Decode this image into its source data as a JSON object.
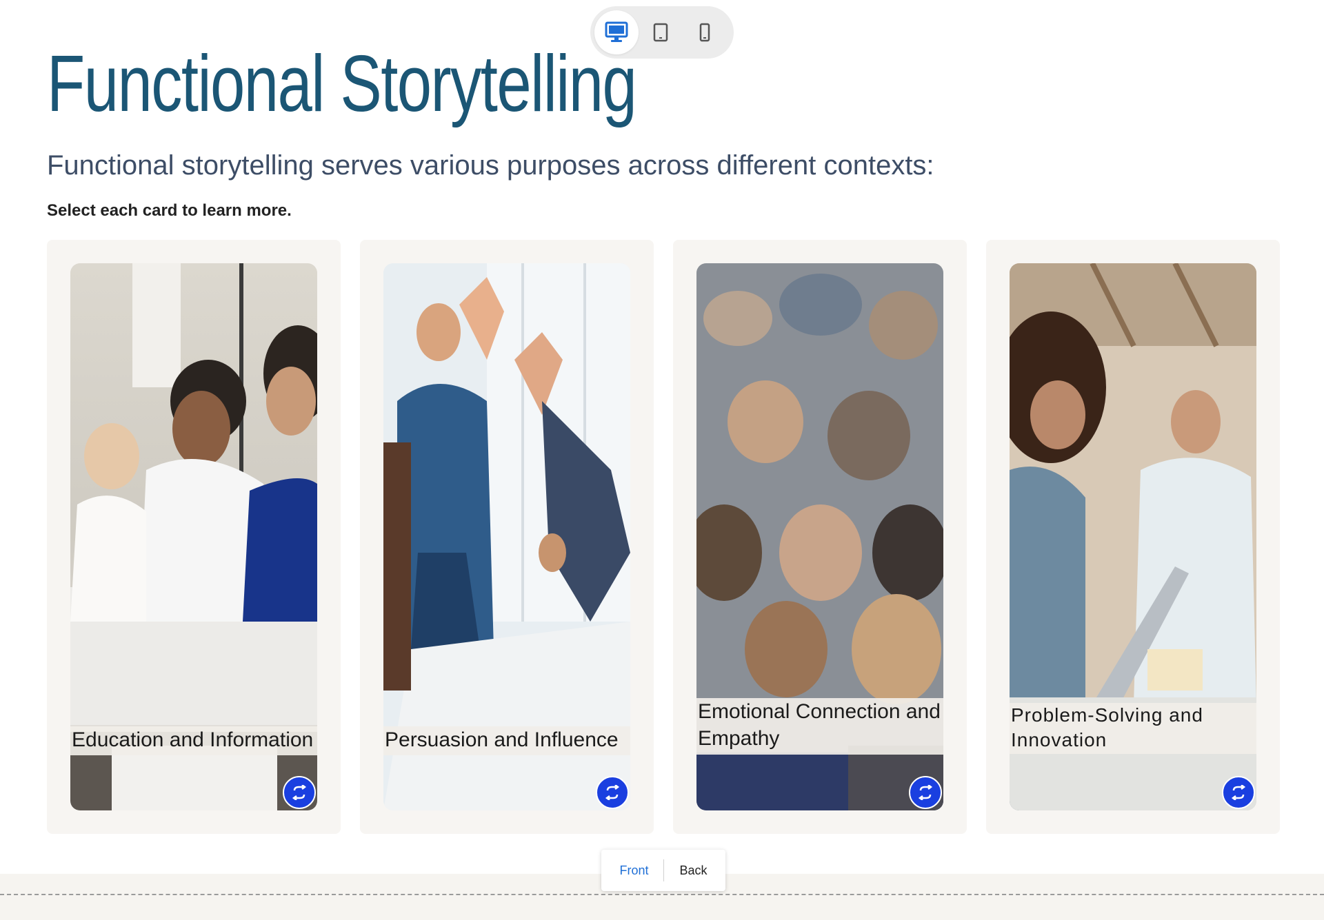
{
  "device_toggle": {
    "options": [
      {
        "icon": "desktop-icon",
        "active": true
      },
      {
        "icon": "tablet-icon",
        "active": false
      },
      {
        "icon": "mobile-icon",
        "active": false
      }
    ],
    "accent": "#1f6fd6"
  },
  "page": {
    "title": "Functional Storytelling",
    "subtitle": "Functional storytelling serves various purposes across different contexts:",
    "instruction": "Select each card to learn more."
  },
  "cards": [
    {
      "label": "Education and Information",
      "label_small_word": "and",
      "flip_icon": "flip-icon"
    },
    {
      "label": "Persuasion and Influence",
      "flip_icon": "flip-icon"
    },
    {
      "label": "Emotional Connection and Empathy",
      "flip_icon": "flip-icon"
    },
    {
      "label": "Problem-Solving and Innovation",
      "flip_icon": "flip-icon"
    }
  ],
  "view_switch": {
    "front": "Front",
    "back": "Back",
    "active": "Front"
  },
  "colors": {
    "title": "#1b5675",
    "subtitle": "#3d4d66",
    "flip_button": "#1a3fe0",
    "card_frame": "#f7f5f2"
  }
}
